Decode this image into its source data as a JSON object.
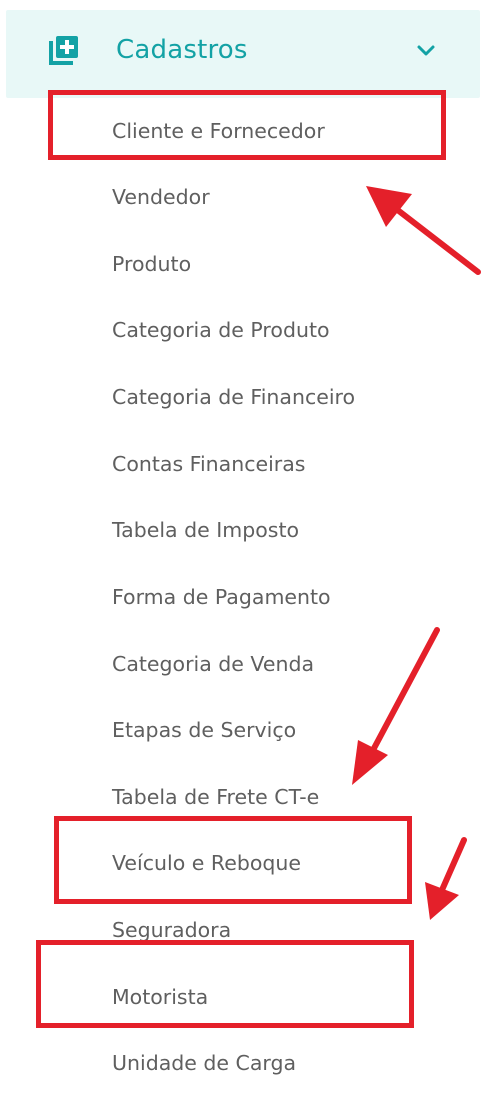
{
  "menu": {
    "title": "Cadastros",
    "icon": "add-box-icon",
    "toggle_icon": "chevron-down-icon",
    "accent_color": "#13a2a5",
    "header_bg": "#e8f8f7",
    "items": [
      {
        "label": "Cliente e Fornecedor"
      },
      {
        "label": "Vendedor"
      },
      {
        "label": "Produto"
      },
      {
        "label": "Categoria de Produto"
      },
      {
        "label": "Categoria de Financeiro"
      },
      {
        "label": "Contas Financeiras"
      },
      {
        "label": "Tabela de Imposto"
      },
      {
        "label": "Forma de Pagamento"
      },
      {
        "label": "Categoria de Venda"
      },
      {
        "label": "Etapas de Serviço"
      },
      {
        "label": "Tabela de Frete CT-e"
      },
      {
        "label": "Veículo e Reboque"
      },
      {
        "label": "Seguradora"
      },
      {
        "label": "Motorista"
      },
      {
        "label": "Unidade de Carga"
      }
    ]
  },
  "annotations": {
    "highlight_color": "#e4202a",
    "highlighted_items": [
      "Cliente e Fornecedor",
      "Veículo e Reboque",
      "Motorista"
    ]
  }
}
